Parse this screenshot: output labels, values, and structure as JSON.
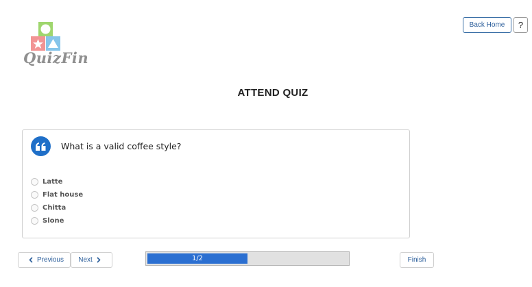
{
  "brand": {
    "name": "QuizFin"
  },
  "header": {
    "back_home_label": "Back Home",
    "help_label": "?"
  },
  "page": {
    "title": "ATTEND QUIZ"
  },
  "question": {
    "text": "What is a valid coffee style?",
    "options": [
      "Latte",
      "Flat house",
      "Chitta",
      "Slone"
    ]
  },
  "navigation": {
    "previous_label": "Previous",
    "next_label": "Next",
    "finish_label": "Finish",
    "progress_text": "1/2",
    "progress_fraction": 0.5
  },
  "colors": {
    "accent": "#1f6fc8",
    "progress_fill": "#2b6fd1",
    "link": "#2a5d9a"
  }
}
